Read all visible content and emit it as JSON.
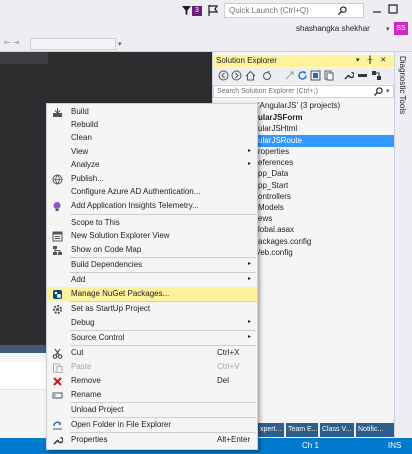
{
  "titlebar": {
    "notification_count": "3",
    "quick_launch_placeholder": "Quick Launch (Ctrl+Q)",
    "user_name": "shashangka shekhar",
    "user_caret": "▾",
    "user_initials": "SS"
  },
  "solution_explorer": {
    "title": "Solution Explorer",
    "title_buttons": "▾ ╫ ✕",
    "search_placeholder": "Search Solution Explorer (Ctrl+;)",
    "search_caret": "▾",
    "tree": [
      "'AngularJS' (3 projects)",
      "ularJSForm",
      "ularJSHtml",
      "ularJSRoute",
      "roperties",
      "eferences",
      "pp_Data",
      "pp_Start",
      "ontrollers",
      "Models",
      "ews",
      "lobal.asax",
      "ackages.config",
      "/eb.config"
    ]
  },
  "diagnostic_tab": "Diagnostic Tools",
  "bottom_tabs": [
    "xpert...",
    "Team E...",
    "Class V...",
    "Notific..."
  ],
  "status": {
    "ch": "Ch 1",
    "ins": "INS"
  },
  "context_menu": {
    "items": [
      {
        "label": "Build",
        "icon": "build-icon"
      },
      {
        "label": "Rebuild"
      },
      {
        "label": "Clean"
      },
      {
        "label": "View",
        "submenu": "▸"
      },
      {
        "label": "Analyze",
        "submenu": "▸"
      },
      {
        "label": "Publish...",
        "icon": "publish-icon"
      },
      {
        "label": "Configure Azure AD Authentication..."
      },
      {
        "label": "Add Application Insights Telemetry...",
        "icon": "insights-icon"
      },
      {
        "label": "Scope to This"
      },
      {
        "label": "New Solution Explorer View",
        "icon": "new-view-icon"
      },
      {
        "label": "Show on Code Map",
        "icon": "code-map-icon"
      },
      {
        "label": "Build Dependencies",
        "submenu": "▸"
      },
      {
        "label": "Add",
        "submenu": "▸"
      },
      {
        "label": "Manage NuGet Packages...",
        "icon": "nuget-icon"
      },
      {
        "label": "Set as StartUp Project",
        "icon": "gear-icon"
      },
      {
        "label": "Debug",
        "submenu": "▸"
      },
      {
        "label": "Source Control",
        "submenu": "▸"
      },
      {
        "label": "Cut",
        "icon": "cut-icon",
        "shortcut": "Ctrl+X"
      },
      {
        "label": "Paste",
        "icon": "paste-icon",
        "shortcut": "Ctrl+V"
      },
      {
        "label": "Remove",
        "icon": "remove-icon",
        "shortcut": "Del"
      },
      {
        "label": "Rename",
        "icon": "rename-icon"
      },
      {
        "label": "Unload Project"
      },
      {
        "label": "Open Folder in File Explorer",
        "icon": "open-folder-icon"
      },
      {
        "label": "Properties",
        "icon": "wrench-icon",
        "shortcut": "Alt+Enter"
      }
    ]
  },
  "colors": {
    "highlight": "#fff29d",
    "selection": "#3399ff",
    "statusbar": "#007acc",
    "avatar": "#cf28c7",
    "badge": "#68217a"
  }
}
